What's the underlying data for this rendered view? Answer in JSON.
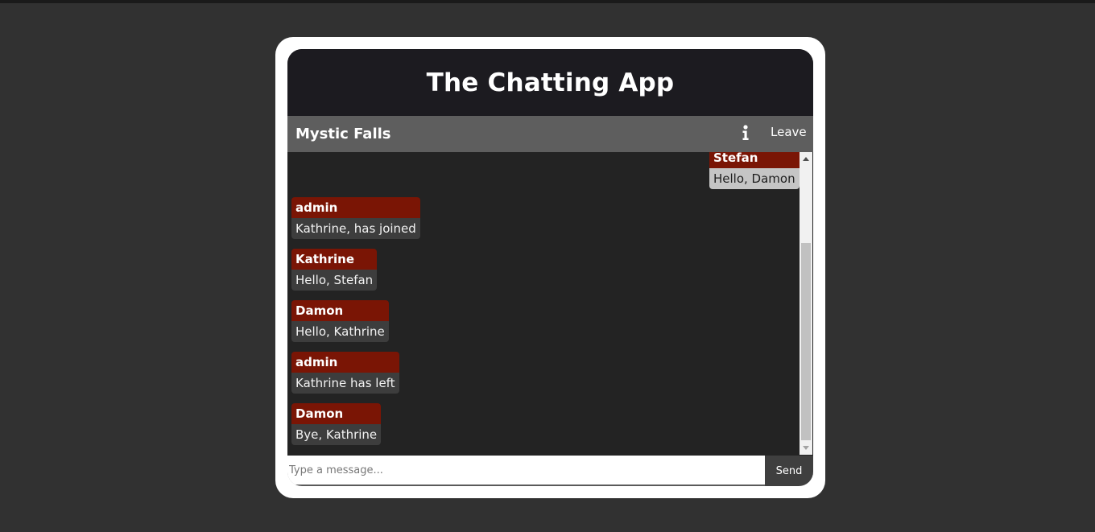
{
  "app": {
    "title": "The Chatting App"
  },
  "room": {
    "name": "Mystic Falls",
    "info_icon": "info-icon",
    "leave_label": "Leave"
  },
  "messages": [
    {
      "sender": "Stefan",
      "text": "Hello, Damon",
      "own": true
    },
    {
      "sender": "admin",
      "text": "Kathrine, has joined",
      "own": false
    },
    {
      "sender": "Kathrine",
      "text": "Hello, Stefan",
      "own": false
    },
    {
      "sender": "Damon",
      "text": "Hello, Kathrine",
      "own": false
    },
    {
      "sender": "admin",
      "text": "Kathrine has left",
      "own": false
    },
    {
      "sender": "Damon",
      "text": "Bye, Kathrine",
      "own": false
    }
  ],
  "composer": {
    "placeholder": "Type a message...",
    "value": "",
    "send_label": "Send"
  },
  "colors": {
    "background": "#313131",
    "header": "#1c1b20",
    "room_bar": "#5e5e5e",
    "chat_area": "#232323",
    "sender_badge": "#7a1505",
    "message_bubble": "#3d3d3d",
    "own_message_bubble": "#c5c5c5",
    "send_button": "#3f3f3f"
  }
}
